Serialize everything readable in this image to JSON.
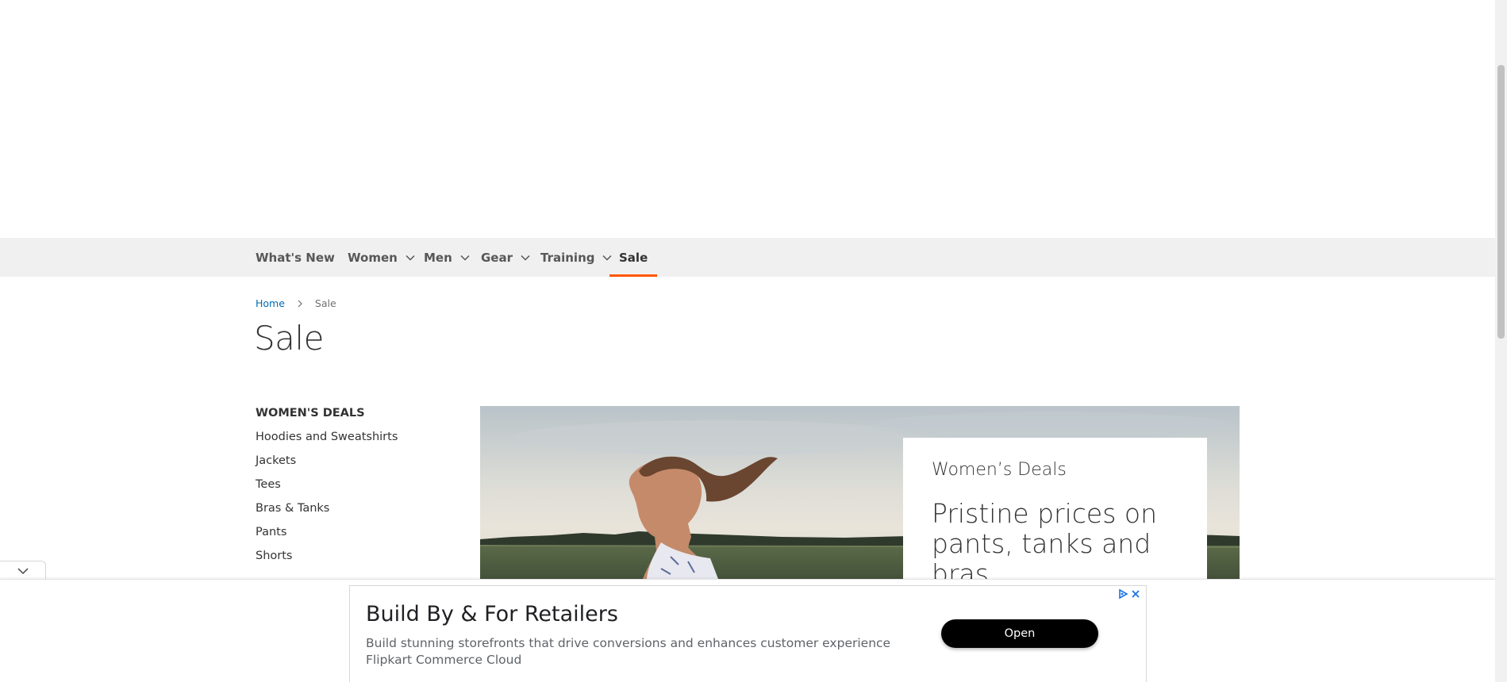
{
  "nav": {
    "items": [
      {
        "label": "What's New",
        "has_dropdown": false
      },
      {
        "label": "Women",
        "has_dropdown": true
      },
      {
        "label": "Men",
        "has_dropdown": true
      },
      {
        "label": "Gear",
        "has_dropdown": true
      },
      {
        "label": "Training",
        "has_dropdown": true
      },
      {
        "label": "Sale",
        "has_dropdown": false,
        "active": true
      }
    ],
    "active_color": "#ff5501"
  },
  "breadcrumb": {
    "home": "Home",
    "current": "Sale"
  },
  "page": {
    "title": "Sale"
  },
  "sidebar": {
    "heading": "WOMEN'S DEALS",
    "links": [
      "Hoodies and Sweatshirts",
      "Jackets",
      "Tees",
      "Bras & Tanks",
      "Pants",
      "Shorts"
    ]
  },
  "banner": {
    "eyebrow": "Women’s Deals",
    "headline": "Pristine prices on pants, tanks and bras."
  },
  "ad": {
    "title": "Build By & For Retailers",
    "description": "Build stunning storefronts that drive conversions and enhances customer experience",
    "advertiser": "Flipkart Commerce Cloud",
    "cta": "Open",
    "icons": [
      "ad-choices-icon",
      "close-icon"
    ]
  },
  "colors": {
    "link": "#006bb4",
    "nav_bg": "#f0f0f0",
    "accent": "#ff5501"
  }
}
